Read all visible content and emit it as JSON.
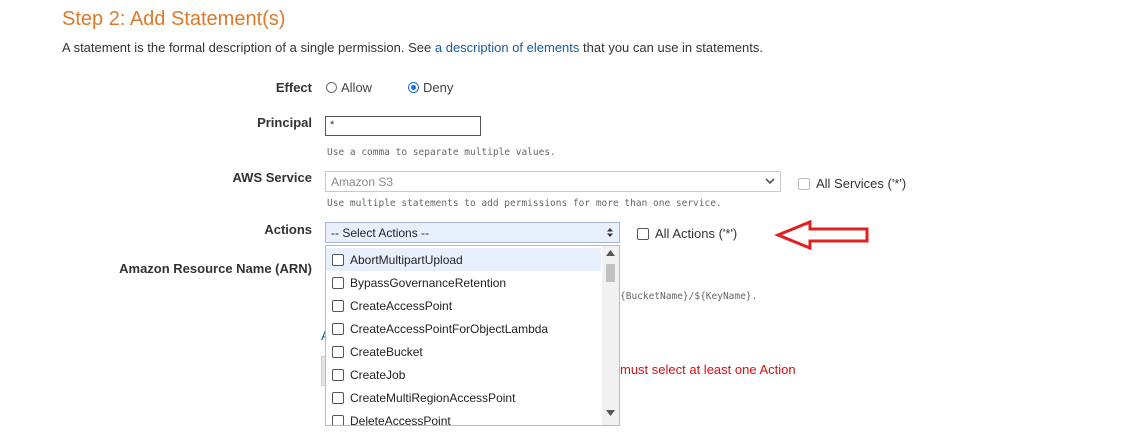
{
  "header": {
    "title": "Step 2: Add Statement(s)",
    "desc_prefix": "A statement is the formal description of a single permission. See",
    "desc_link": "a description of elements",
    "desc_suffix": "that you can use in statements."
  },
  "form": {
    "effect": {
      "label": "Effect",
      "options": [
        {
          "label": "Allow",
          "selected": false
        },
        {
          "label": "Deny",
          "selected": true
        }
      ]
    },
    "principal": {
      "label": "Principal",
      "value": "*",
      "help": "Use a comma to separate multiple values."
    },
    "service": {
      "label": "AWS Service",
      "value": "Amazon S3",
      "help": "Use multiple statements to add permissions for more than one service.",
      "all_label": "All Services ('*')"
    },
    "actions": {
      "label": "Actions",
      "value": "-- Select Actions --",
      "all_label": "All Actions ('*')",
      "options": [
        "AbortMultipartUpload",
        "BypassGovernanceRetention",
        "CreateAccessPoint",
        "CreateAccessPointForObjectLambda",
        "CreateBucket",
        "CreateJob",
        "CreateMultiRegionAccessPoint",
        "DeleteAccessPoint"
      ]
    },
    "arn": {
      "label": "Amazon Resource Name (ARN)",
      "help_visible": "{BucketName}/${KeyName}.",
      "link_fragment": "A"
    },
    "error": "must select at least one Action"
  },
  "colors": {
    "title": "#e0782a",
    "link": "#1a5ba0",
    "error": "#d41010",
    "arrow": "#e02020",
    "selected_radio": "#1b6fd9"
  },
  "icons": {
    "arrow": "left-arrow-icon",
    "select_caret": "chevron-down-icon",
    "actions_caret": "up-down-icon"
  }
}
